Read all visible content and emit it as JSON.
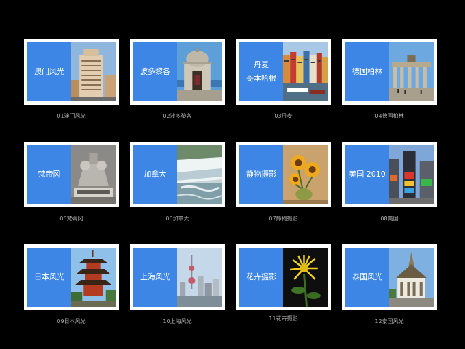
{
  "tiles": [
    {
      "title_lines": [
        "澳门风光"
      ],
      "caption": "01澳门风光",
      "photo": "macau-hotel-photo"
    },
    {
      "title_lines": [
        "波多黎各"
      ],
      "caption": "02波多黎各",
      "photo": "puerto-rico-watchtower-photo"
    },
    {
      "title_lines": [
        "丹麦",
        "哥本哈根"
      ],
      "caption": "03丹麦",
      "photo": "copenhagen-harbor-photo"
    },
    {
      "title_lines": [
        "德国柏林"
      ],
      "caption": "04德国柏林",
      "photo": "brandenburg-gate-photo"
    },
    {
      "title_lines": [
        "梵帝冈"
      ],
      "caption": "05梵蒂冈",
      "photo": "vatican-statue-photo"
    },
    {
      "title_lines": [
        "加拿大"
      ],
      "caption": "06加拿大",
      "photo": "niagara-falls-photo"
    },
    {
      "title_lines": [
        "静物摄影"
      ],
      "caption": "07静物摄影",
      "photo": "sunflowers-photo"
    },
    {
      "title_lines": [
        "美国 2010"
      ],
      "caption": "08美国",
      "photo": "times-square-photo"
    },
    {
      "title_lines": [
        "日本风光"
      ],
      "caption": "09日本风光",
      "photo": "pagoda-photo"
    },
    {
      "title_lines": [
        "上海风光"
      ],
      "caption": "10上海风光",
      "photo": "shanghai-skyline-photo"
    },
    {
      "title_lines": [
        "花卉摄影"
      ],
      "caption": "11花卉摄影",
      "photo": "chrysanthemum-photo"
    },
    {
      "title_lines": [
        "泰国风光"
      ],
      "caption": "12泰国风光",
      "photo": "thai-temple-photo"
    }
  ],
  "colors": {
    "tile_blue": "#3d86e6",
    "frame": "#ffffff",
    "background": "#000000",
    "caption": "#a8a8a8"
  }
}
